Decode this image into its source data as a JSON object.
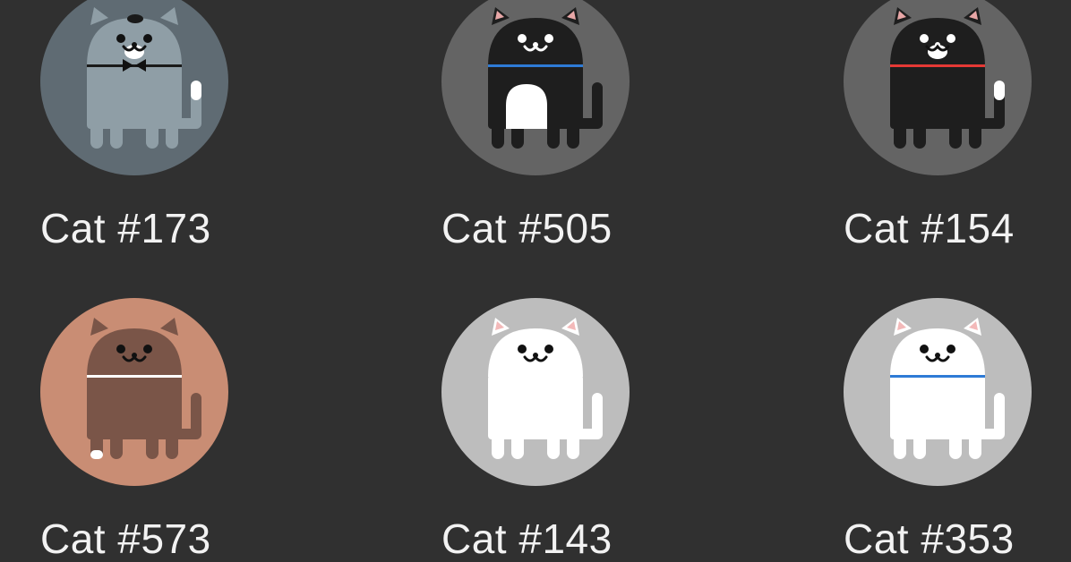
{
  "cats": [
    {
      "name": "Cat #173",
      "bg": "#5f6b73",
      "body": "#8f9ea6",
      "ear": "#8f9ea6",
      "collar": "#1a1a1a",
      "bowtie": true,
      "belly": "",
      "tail_tip": "#ffffff",
      "foot_tip": "",
      "face": "#111111",
      "mouth": "#ffffff",
      "head_spot": "#1a1a1a",
      "muzzle": "#ffffff"
    },
    {
      "name": "Cat #505",
      "bg": "#646464",
      "body": "#1e1e1e",
      "ear": "#e8a7a7",
      "collar": "#2e7bd6",
      "bowtie": false,
      "belly": "#ffffff",
      "tail_tip": "",
      "foot_tip": "",
      "face": "#ffffff",
      "mouth": "#ffffff",
      "head_spot": "",
      "muzzle": ""
    },
    {
      "name": "Cat #154",
      "bg": "#646464",
      "body": "#1e1e1e",
      "ear": "#e8a7a7",
      "collar": "#e53935",
      "bowtie": false,
      "belly": "",
      "tail_tip": "#ffffff",
      "foot_tip": "",
      "face": "#ffffff",
      "mouth": "#ffffff",
      "head_spot": "",
      "muzzle": "#ffffff"
    },
    {
      "name": "Cat #573",
      "bg": "#c98d74",
      "body": "#7a5548",
      "ear": "#7a5548",
      "collar": "#ffffff",
      "bowtie": false,
      "belly": "",
      "tail_tip": "",
      "foot_tip": "#ffffff",
      "face": "#111111",
      "mouth": "#111111",
      "head_spot": "",
      "muzzle": ""
    },
    {
      "name": "Cat #143",
      "bg": "#bdbdbd",
      "body": "#ffffff",
      "ear": "#f3b9b9",
      "collar": "",
      "bowtie": false,
      "belly": "",
      "tail_tip": "",
      "foot_tip": "",
      "face": "#111111",
      "mouth": "#111111",
      "head_spot": "",
      "muzzle": ""
    },
    {
      "name": "Cat #353",
      "bg": "#bdbdbd",
      "body": "#ffffff",
      "ear": "#f3b9b9",
      "collar": "#2e7bd6",
      "bowtie": false,
      "belly": "",
      "tail_tip": "",
      "foot_tip": "",
      "face": "#111111",
      "mouth": "#111111",
      "head_spot": "",
      "muzzle": ""
    }
  ]
}
